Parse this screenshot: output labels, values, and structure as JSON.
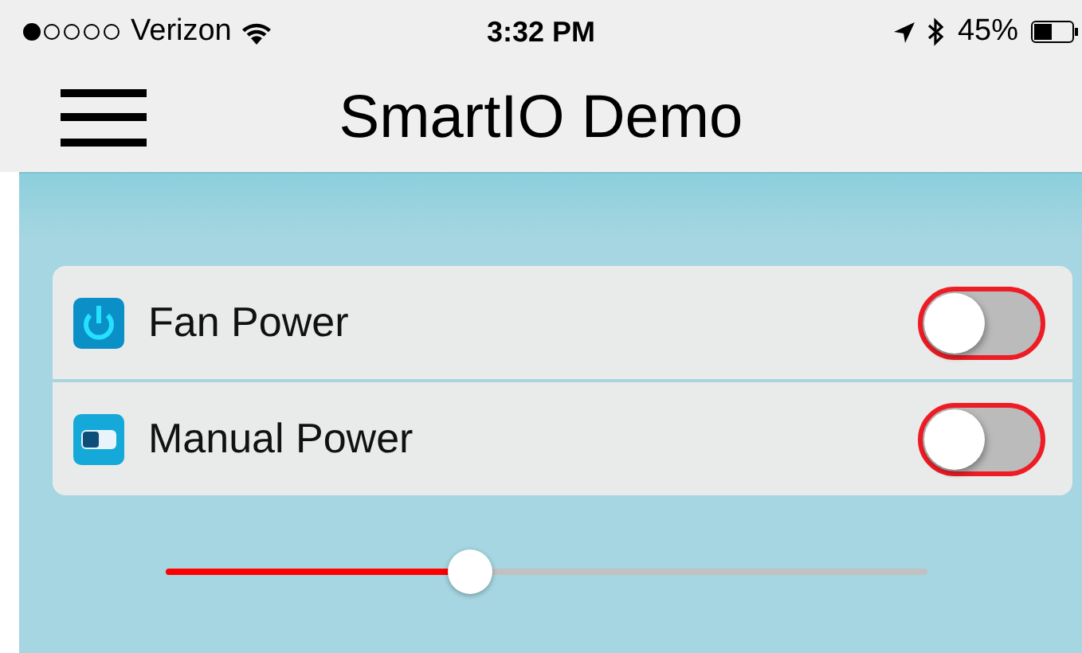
{
  "status_bar": {
    "carrier": "Verizon",
    "time": "3:32 PM",
    "battery": "45%"
  },
  "nav_bar": {
    "title": "SmartIO Demo"
  },
  "settings": [
    {
      "kind": "power",
      "label": "Fan Power",
      "on": false
    },
    {
      "kind": "toggle",
      "label": "Manual Power",
      "on": false
    }
  ],
  "slider": {
    "level": 0.4
  }
}
